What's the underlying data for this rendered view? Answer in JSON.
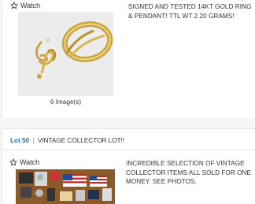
{
  "lots": [
    {
      "watch_label": "Watch",
      "description": "SIGNED AND TESTED 14KT GOLD RING & PENDANT! TTL WT 2.20 GRAMS!",
      "image_count": "6 Image(s)"
    },
    {
      "lot_number": "Lot 50",
      "separator": "|",
      "title": "VINTAGE COLLECTOR LOT!!",
      "watch_label": "Watch",
      "description": "INCREDIBLE SELECTION OF VINTAGE COLLECTOR ITEMS ALL SOLD FOR ONE MONEY. SEE PHOTOS."
    }
  ],
  "icons": {
    "watch": "star-outline-icon"
  },
  "colors": {
    "lot_link": "#1e6fb8",
    "background": "#f5f6f8"
  }
}
